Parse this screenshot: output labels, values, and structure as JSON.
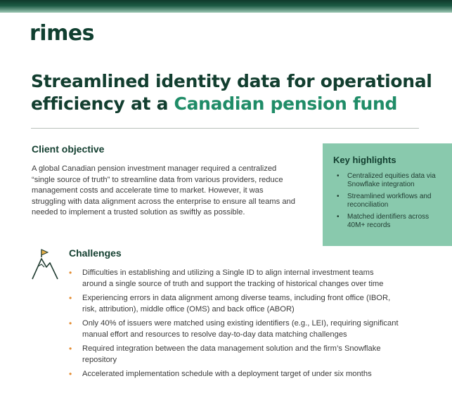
{
  "brand": {
    "logo_text": "rimes"
  },
  "title": {
    "line1": "Streamlined identity data for operational efficiency at a ",
    "accent": "Canadian pension fund"
  },
  "client_objective": {
    "heading": "Client objective",
    "text": "A global Canadian pension investment manager required a centralized “single source of truth” to streamline data from various providers, reduce management costs and accelerate time to market. However, it was struggling with data alignment across the enterprise to ensure all teams and needed to implement a trusted solution as swiftly as possible."
  },
  "key_highlights": {
    "heading": "Key highlights",
    "items": [
      "Centralized equities data via Snowflake integration",
      "Streamlined workflows and reconciliation",
      "Matched identifiers across 40M+ records"
    ]
  },
  "challenges": {
    "heading": "Challenges",
    "icon": "mountain-flag-icon",
    "items": [
      "Difficulties in establishing and utilizing a Single ID to align internal investment teams around a single source of truth and support the tracking of historical changes over time",
      "Experiencing errors in data alignment among diverse teams, including front office (IBOR, risk, attribution), middle office (OMS) and back office (ABOR)",
      "Only 40% of issuers were matched using existing identifiers (e.g., LEI), requiring significant manual effort and resources to resolve day-to-day data matching challenges",
      "Required integration between the data management solution and the firm’s Snowflake repository",
      "Accelerated implementation schedule with a deployment target of under six months"
    ]
  },
  "colors": {
    "brand_dark": "#123e2f",
    "accent_green": "#1f8c67",
    "highlight_box": "#89c9ad",
    "bullet_orange": "#e38a2d"
  }
}
